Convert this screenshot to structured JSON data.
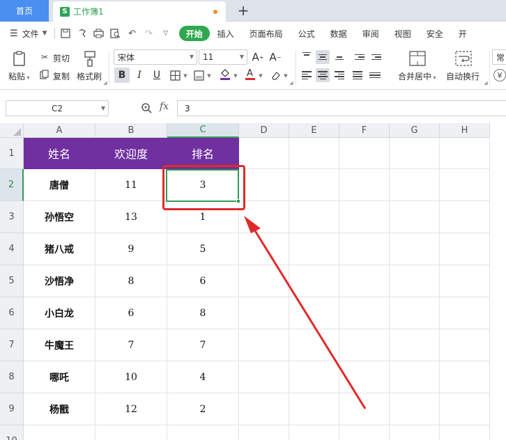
{
  "tabs": {
    "home": "首页",
    "doc": "工作簿1",
    "doc_icon_letter": "S"
  },
  "menubar": {
    "file": "文件",
    "items": [
      "开始",
      "插入",
      "页面布局",
      "公式",
      "数据",
      "审阅",
      "视图",
      "安全",
      "开"
    ]
  },
  "ribbon": {
    "paste": "粘贴",
    "cut": "剪切",
    "copy": "复制",
    "format_painter": "格式刷",
    "font_name": "宋体",
    "font_size": "11",
    "merge_center": "合并居中",
    "wrap_text": "自动换行",
    "number_format": "常"
  },
  "formula_bar": {
    "cell_ref": "C2",
    "fx": "fx",
    "value": "3"
  },
  "grid": {
    "columns": [
      "A",
      "B",
      "C",
      "D",
      "E",
      "F",
      "G",
      "H"
    ],
    "rows": [
      "1",
      "2",
      "3",
      "4",
      "5",
      "6",
      "7",
      "8",
      "9",
      "10"
    ],
    "header": [
      "姓名",
      "欢迎度",
      "排名"
    ],
    "data": [
      [
        "唐僧",
        "11",
        "3"
      ],
      [
        "孙悟空",
        "13",
        "1"
      ],
      [
        "猪八戒",
        "9",
        "5"
      ],
      [
        "沙悟净",
        "8",
        "6"
      ],
      [
        "小白龙",
        "6",
        "8"
      ],
      [
        "牛魔王",
        "7",
        "7"
      ],
      [
        "哪吒",
        "10",
        "4"
      ],
      [
        "杨戬",
        "12",
        "2"
      ]
    ]
  },
  "colors": {
    "header_fill": "#7030a0",
    "selection": "#2f9e55",
    "annotation": "#e02a2a"
  }
}
